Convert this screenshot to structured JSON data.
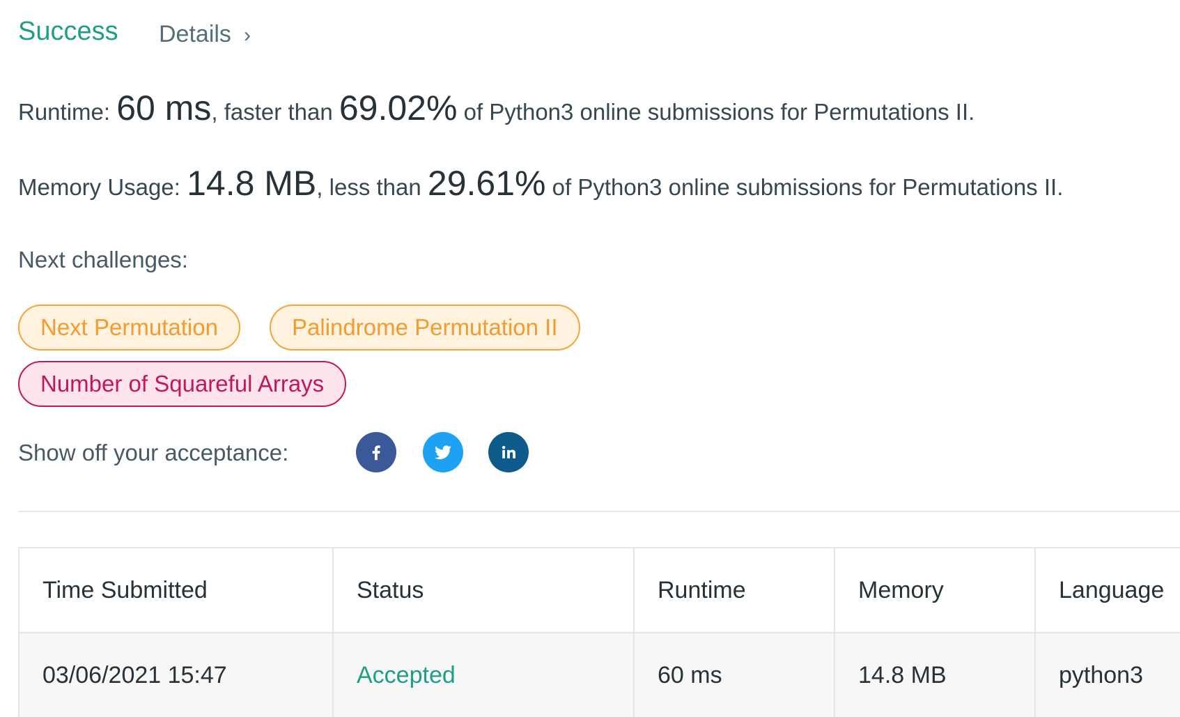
{
  "result": {
    "status": "Success",
    "details_label": "Details",
    "details_chevron": "›"
  },
  "runtime": {
    "label": "Runtime:",
    "value": "60 ms",
    "comparison_text": ", faster than",
    "percent": "69.02%",
    "suffix": "of Python3 online submissions for Permutations II."
  },
  "memory": {
    "label": "Memory Usage:",
    "value": "14.8 MB",
    "comparison_text": ", less than",
    "percent": "29.61%",
    "suffix": "of Python3 online submissions for Permutations II."
  },
  "next_challenges": {
    "label": "Next challenges:",
    "items": [
      {
        "label": "Next Permutation",
        "difficulty": "medium"
      },
      {
        "label": "Palindrome Permutation II",
        "difficulty": "medium"
      },
      {
        "label": "Number of Squareful Arrays",
        "difficulty": "hard"
      }
    ]
  },
  "share": {
    "label": "Show off your acceptance:",
    "icons": [
      {
        "name": "facebook-icon",
        "color": "#3b5998"
      },
      {
        "name": "twitter-icon",
        "color": "#1da1f2"
      },
      {
        "name": "linkedin-icon",
        "color": "#0e5a8a"
      }
    ]
  },
  "submissions_table": {
    "columns": [
      "Time Submitted",
      "Status",
      "Runtime",
      "Memory",
      "Language"
    ],
    "rows": [
      {
        "time_submitted": "03/06/2021 15:47",
        "status": "Accepted",
        "runtime": "60 ms",
        "memory": "14.8 MB",
        "language": "python3"
      }
    ]
  },
  "colors": {
    "success": "#1f9e86",
    "medium_border": "#f5a43a",
    "medium_bg": "#fff3e0",
    "hard_border": "#c2185b",
    "hard_bg": "#fde4ec"
  }
}
